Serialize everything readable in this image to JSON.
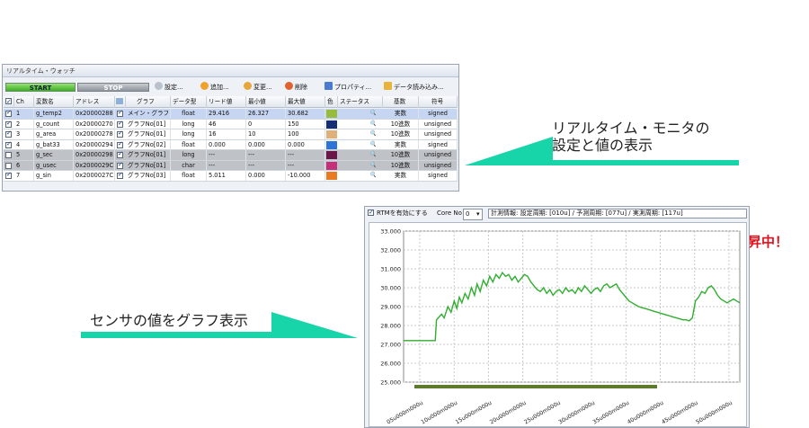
{
  "watch": {
    "title": "リアルタイム・ウォッチ",
    "toolbar": {
      "start": "START",
      "stop": "STOP",
      "settings": "設定...",
      "add": "追加...",
      "change": "変更...",
      "delete": "削除",
      "properties": "プロパティ...",
      "import": "データ読み込み..."
    },
    "columns": {
      "ch": "Ch",
      "var": "変数名",
      "addr": "アドレス",
      "graph": "グラフ",
      "type": "データ型",
      "read": "リード値",
      "min": "最小値",
      "max": "最大値",
      "color": "色",
      "status": "ステータス",
      "radix": "基数",
      "sign": "符号"
    },
    "rows": [
      {
        "ch": "1",
        "var": "g_temp2",
        "addr": "0x20000288",
        "graph": "メイン・グラフ",
        "type": "float",
        "read": "29.416",
        "min": "26.327",
        "max": "30.682",
        "color": "#97bb3a",
        "radix": "実数",
        "sign": "signed",
        "checked": true,
        "state": "sel"
      },
      {
        "ch": "2",
        "var": "g_count",
        "addr": "0x20000270",
        "graph": "グラフNo[01]",
        "type": "long",
        "read": "46",
        "min": "0",
        "max": "150",
        "color": "#142f73",
        "radix": "10進数",
        "sign": "unsigned",
        "checked": true,
        "state": ""
      },
      {
        "ch": "3",
        "var": "g_area",
        "addr": "0x20000278",
        "graph": "グラフNo[01]",
        "type": "long",
        "read": "16",
        "min": "10",
        "max": "100",
        "color": "#e0b07a",
        "radix": "10進数",
        "sign": "unsigned",
        "checked": true,
        "state": ""
      },
      {
        "ch": "4",
        "var": "g_bat33",
        "addr": "0x20000294",
        "graph": "グラフNo[02]",
        "type": "float",
        "read": "0.000",
        "min": "0.000",
        "max": "0.000",
        "color": "#2c74d8",
        "radix": "実数",
        "sign": "signed",
        "checked": true,
        "state": ""
      },
      {
        "ch": "5",
        "var": "g_sec",
        "addr": "0x20000298",
        "graph": "グラフNo[01]",
        "type": "long",
        "read": "---",
        "min": "---",
        "max": "---",
        "color": "#6a1646",
        "radix": "10進数",
        "sign": "unsigned",
        "checked": false,
        "state": "dis"
      },
      {
        "ch": "6",
        "var": "g_usec",
        "addr": "0x2000029C",
        "graph": "グラフNo[01]",
        "type": "char",
        "read": "---",
        "min": "---",
        "max": "---",
        "color": "#c2307a",
        "radix": "10進数",
        "sign": "unsigned",
        "checked": false,
        "state": "dis"
      },
      {
        "ch": "7",
        "var": "g_sin",
        "addr": "0x2000027C",
        "graph": "グラフNo[03]",
        "type": "float",
        "read": "5.011",
        "min": "0.000",
        "max": "-10.000",
        "color": "#e87b22",
        "radix": "実数",
        "sign": "signed",
        "checked": true,
        "state": ""
      }
    ]
  },
  "labels": {
    "monitor_line1": "リアルタイム・モニタの",
    "monitor_line2": "設定と値の表示",
    "sensor": "センサの値をグラフ表示",
    "warning": "温度上昇中！"
  },
  "chartbar": {
    "rtm_enable": "RTMを有効にする",
    "core_label": "Core No",
    "core_value": "0",
    "info": "計測情報: 設定周期: [010u] / 予測周期: [077u] / 実測周期: [117u]"
  },
  "chart_data": {
    "type": "line",
    "ylim": [
      25.0,
      33.0
    ],
    "yticks": [
      "33.000",
      "32.000",
      "31.000",
      "30.000",
      "29.000",
      "28.000",
      "27.000",
      "26.000",
      "25.000"
    ],
    "xticks": [
      "05u000m000u",
      "10u000m000u",
      "15u000m000u",
      "20u000m000u",
      "25u000m000u",
      "30u000m000u",
      "35u000m000u",
      "40u000m000u",
      "45u000m000u",
      "50u000m000u"
    ],
    "grid": true,
    "line_color": "#2fae2f",
    "series": [
      {
        "x": [
          0,
          1,
          2,
          3,
          4,
          5,
          5.2,
          6,
          6.4,
          7,
          7.5,
          8,
          8.4,
          8.8,
          9.2,
          9.7,
          10.2,
          10.7,
          11.2,
          11.6,
          12.1,
          12.6,
          13.1,
          13.6,
          14.1,
          14.6,
          15.1,
          15.6,
          16.1,
          16.6,
          17.1,
          17.6,
          18.1,
          18.6,
          19.1,
          19.6,
          20.1,
          20.6,
          21.1,
          21.6,
          22.1,
          22.6,
          23.1,
          23.6,
          24.1,
          24.6,
          25.1,
          25.6,
          26.1,
          26.6,
          27.1,
          27.6,
          28.1,
          28.6,
          29.1,
          29.6,
          30.1,
          30.6,
          31.1,
          31.6,
          32.1,
          32.6,
          33.1,
          33.6,
          34.1,
          34.6,
          35.1,
          35.6,
          36.1,
          36.6,
          37.1,
          37.6,
          38.1,
          38.6,
          39.1,
          39.6,
          40.1,
          40.6,
          41.1,
          41.6,
          42.1,
          42.6,
          43.1,
          43.6,
          44.1,
          44.6,
          45.1,
          45.6,
          46.1,
          46.6,
          47.1,
          47.6,
          48.1,
          48.6,
          49.1,
          49.6,
          50.1,
          50.6,
          51.1,
          51.6,
          52.1,
          52.6,
          53.1
        ],
        "y": [
          27.2,
          27.2,
          27.2,
          27.2,
          27.2,
          27.2,
          28.3,
          28.6,
          28.4,
          29.0,
          28.7,
          29.3,
          28.9,
          29.5,
          29.2,
          29.7,
          29.4,
          30.0,
          29.6,
          30.2,
          29.8,
          30.4,
          30.1,
          30.6,
          30.3,
          30.7,
          30.5,
          30.8,
          30.6,
          30.7,
          30.4,
          30.6,
          30.3,
          30.5,
          30.7,
          30.6,
          30.3,
          30.1,
          29.9,
          29.8,
          30.0,
          29.7,
          29.9,
          29.6,
          29.8,
          29.9,
          29.7,
          30.0,
          29.8,
          29.9,
          29.7,
          30.0,
          29.8,
          30.1,
          29.9,
          29.7,
          29.9,
          30.0,
          29.8,
          30.1,
          30.2,
          30.0,
          30.1,
          30.2,
          29.9,
          29.7,
          29.5,
          29.3,
          29.2,
          29.1,
          29.0,
          28.95,
          28.9,
          28.85,
          28.8,
          28.75,
          28.7,
          28.65,
          28.6,
          28.55,
          28.5,
          28.45,
          28.4,
          28.35,
          28.3,
          28.3,
          28.25,
          28.4,
          29.3,
          29.5,
          29.8,
          29.7,
          30.0,
          30.1,
          29.9,
          29.6,
          29.4,
          29.3,
          29.2,
          29.3,
          29.4,
          29.3,
          29.2
        ]
      }
    ]
  }
}
